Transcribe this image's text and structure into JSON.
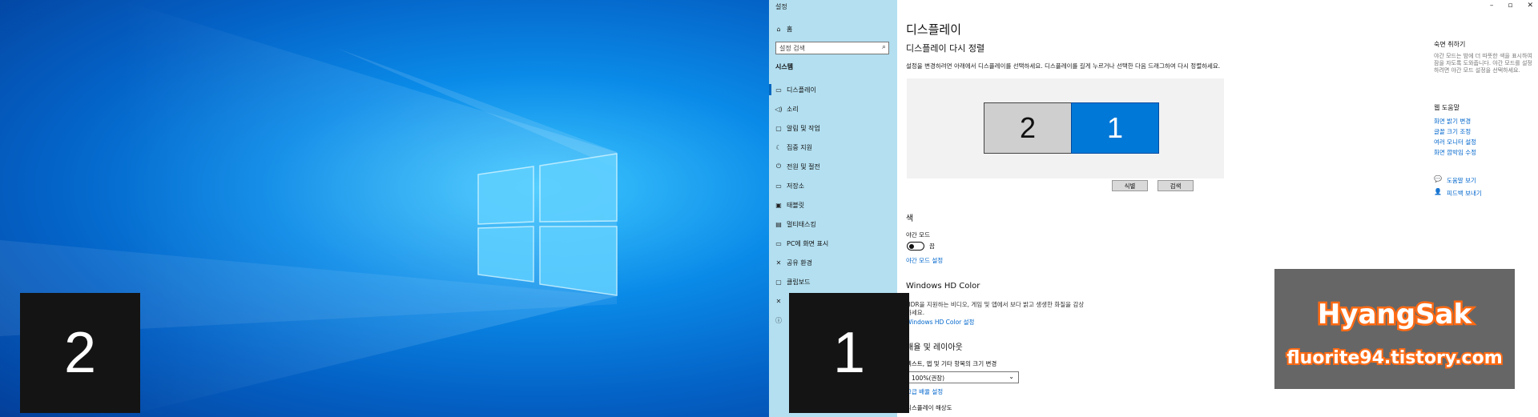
{
  "desktop2": {
    "display_number": "2"
  },
  "settings": {
    "window_title": "설정",
    "window_controls": {
      "minimize": "–",
      "maximize": "▫",
      "close": "✕"
    },
    "sidebar": {
      "home": "홈",
      "search_placeholder": "설정 검색",
      "section": "시스템",
      "items": [
        {
          "label": "디스플레이",
          "icon": "display-icon"
        },
        {
          "label": "소리",
          "icon": "sound-icon"
        },
        {
          "label": "알림 및 작업",
          "icon": "notification-icon"
        },
        {
          "label": "집중 지원",
          "icon": "focus-icon"
        },
        {
          "label": "전원 및 절전",
          "icon": "power-icon"
        },
        {
          "label": "저장소",
          "icon": "storage-icon"
        },
        {
          "label": "태블릿",
          "icon": "tablet-icon"
        },
        {
          "label": "멀티태스킹",
          "icon": "multitasking-icon"
        },
        {
          "label": "PC에 화면 표시",
          "icon": "project-icon"
        },
        {
          "label": "공유 환경",
          "icon": "share-icon"
        },
        {
          "label": "클립보드",
          "icon": "clipboard-icon"
        }
      ]
    },
    "main": {
      "title": "디스플레이",
      "rearrange_heading": "디스플레이 다시 정렬",
      "rearrange_desc": "설정을 변경하려면 아래에서 디스플레이를 선택하세요. 디스플레이를 길게 누르거나 선택한 다음 드래그하여 다시 정렬하세요.",
      "monitor_labels": [
        "2",
        "1"
      ],
      "identify_button": "식별",
      "detect_button": "검색",
      "color_heading": "색",
      "night_mode_label": "야간 모드",
      "night_mode_state": "끔",
      "night_mode_link": "야간 모드 설정",
      "hdr_heading": "Windows HD Color",
      "hdr_desc_line1": "HDR을 지원하는 비디오, 게임 및 앱에서 보다 밝고 생생한 화질을 감상",
      "hdr_desc_line2": "하세요.",
      "hdr_link": "Windows HD Color 설정",
      "scale_heading": "배율 및 레이아웃",
      "scale_label": "텍스트, 앱 및 기타 항목의 크기 변경",
      "scale_value": "100%(권장)",
      "advanced_scale_link": "고급 배율 설정",
      "resolution_label": "디스플레이 해상도"
    },
    "right_panel": {
      "night_title": "숙면 취하기",
      "night_text": "야간 모드는 밤에 더 따뜻한 색을 표시하여 잠을 자도록 도와줍니다. 야간 모드를 설정하려면 야간 모드 설정을 선택하세요.",
      "web_help_title": "웹 도움말",
      "links": [
        "화면 밝기 변경",
        "글꼴 크기 조정",
        "여러 모니터 설정",
        "화면 깜박임 수정"
      ],
      "get_help": "도움말 보기",
      "feedback": "피드백 보내기"
    },
    "display1": {
      "display_number": "1"
    }
  },
  "watermark": {
    "name": "HyangSak",
    "url": "fluorite94.tistory.com",
    "colors": {
      "fill": "#ffffff",
      "stroke": "#ff6a13",
      "background": "#666666"
    }
  }
}
